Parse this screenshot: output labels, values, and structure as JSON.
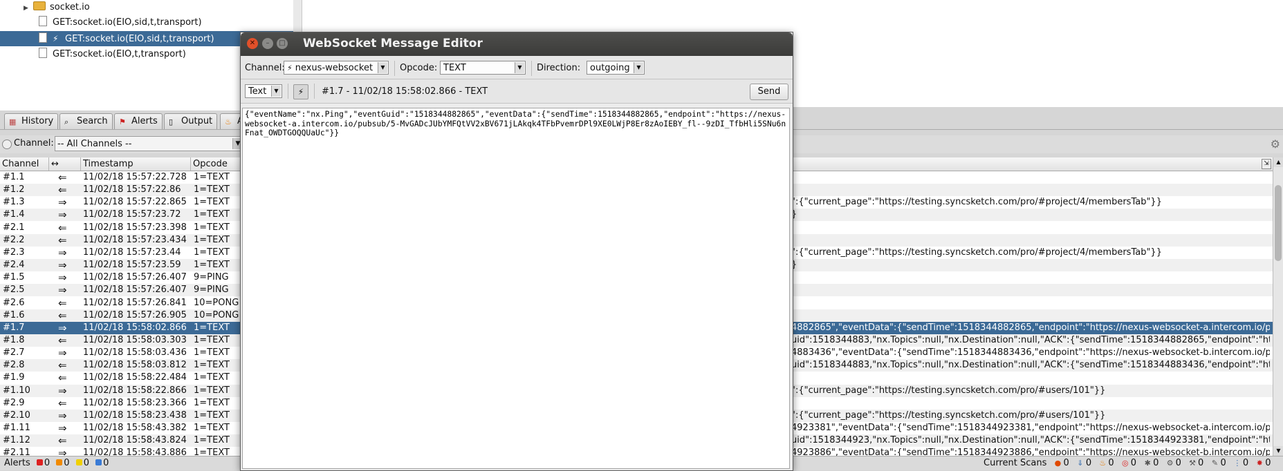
{
  "tree": {
    "folder": "socket.io",
    "items": [
      "GET:socket.io(EIO,sid,t,transport)",
      "GET:socket.io(EIO,sid,t,transport)",
      "GET:socket.io(EIO,t,transport)"
    ]
  },
  "tabs": [
    {
      "label": "History",
      "icon": "calendar-icon"
    },
    {
      "label": "Search",
      "icon": "magnifier-icon"
    },
    {
      "label": "Alerts",
      "icon": "flag-icon"
    },
    {
      "label": "Output",
      "icon": "document-icon"
    },
    {
      "label": "A",
      "icon": "flame-icon"
    }
  ],
  "filter": {
    "label": "Channel:",
    "value": "-- All Channels --"
  },
  "table": {
    "headers": [
      "Channel",
      "↔",
      "Timestamp",
      "Opcode"
    ],
    "rows": [
      {
        "ch": "#1.1",
        "dir": "⇐",
        "ts": "11/02/18 15:57:22.728",
        "op": "1=TEXT",
        "pl": ""
      },
      {
        "ch": "#1.2",
        "dir": "⇐",
        "ts": "11/02/18 15:57:22.86",
        "op": "1=TEXT",
        "pl": ""
      },
      {
        "ch": "#1.3",
        "dir": "⇒",
        "ts": "11/02/18 15:57:22.865",
        "op": "1=TEXT",
        "pl": "\":{\"current_page\":\"https://testing.syncsketch.com/pro/#project/4/membersTab\"}}"
      },
      {
        "ch": "#1.4",
        "dir": "⇒",
        "ts": "11/02/18 15:57:23.72",
        "op": "1=TEXT",
        "pl": "}"
      },
      {
        "ch": "#2.1",
        "dir": "⇐",
        "ts": "11/02/18 15:57:23.398",
        "op": "1=TEXT",
        "pl": ""
      },
      {
        "ch": "#2.2",
        "dir": "⇐",
        "ts": "11/02/18 15:57:23.434",
        "op": "1=TEXT",
        "pl": ""
      },
      {
        "ch": "#2.3",
        "dir": "⇒",
        "ts": "11/02/18 15:57:23.44",
        "op": "1=TEXT",
        "pl": "\":{\"current_page\":\"https://testing.syncsketch.com/pro/#project/4/membersTab\"}}"
      },
      {
        "ch": "#2.4",
        "dir": "⇒",
        "ts": "11/02/18 15:57:23.59",
        "op": "1=TEXT",
        "pl": "}"
      },
      {
        "ch": "#1.5",
        "dir": "⇒",
        "ts": "11/02/18 15:57:26.407",
        "op": "9=PING",
        "pl": ""
      },
      {
        "ch": "#2.5",
        "dir": "⇒",
        "ts": "11/02/18 15:57:26.407",
        "op": "9=PING",
        "pl": ""
      },
      {
        "ch": "#2.6",
        "dir": "⇐",
        "ts": "11/02/18 15:57:26.841",
        "op": "10=PONG",
        "pl": ""
      },
      {
        "ch": "#1.6",
        "dir": "⇐",
        "ts": "11/02/18 15:57:26.905",
        "op": "10=PONG",
        "pl": ""
      },
      {
        "ch": "#1.7",
        "dir": "⇒",
        "ts": "11/02/18 15:58:02.866",
        "op": "1=TEXT",
        "pl": "4882865\",\"eventData\":{\"sendTime\":1518344882865,\"endpoint\":\"https://nexus-websocket-a.intercom.io/pub..."
      },
      {
        "ch": "#1.8",
        "dir": "⇐",
        "ts": "11/02/18 15:58:03.303",
        "op": "1=TEXT",
        "pl": "uid\":1518344883,\"nx.Topics\":null,\"nx.Destination\":null,\"ACK\":{\"sendTime\":1518344882865,\"endpoint\":\"http..."
      },
      {
        "ch": "#2.7",
        "dir": "⇒",
        "ts": "11/02/18 15:58:03.436",
        "op": "1=TEXT",
        "pl": "4883436\",\"eventData\":{\"sendTime\":1518344883436,\"endpoint\":\"https://nexus-websocket-b.intercom.io/pub..."
      },
      {
        "ch": "#2.8",
        "dir": "⇐",
        "ts": "11/02/18 15:58:03.812",
        "op": "1=TEXT",
        "pl": "uid\":1518344883,\"nx.Topics\":null,\"nx.Destination\":null,\"ACK\":{\"sendTime\":1518344883436,\"endpoint\":\"http..."
      },
      {
        "ch": "#1.9",
        "dir": "⇐",
        "ts": "11/02/18 15:58:22.484",
        "op": "1=TEXT",
        "pl": ""
      },
      {
        "ch": "#1.10",
        "dir": "⇒",
        "ts": "11/02/18 15:58:22.866",
        "op": "1=TEXT",
        "pl": "\":{\"current_page\":\"https://testing.syncsketch.com/pro/#users/101\"}}"
      },
      {
        "ch": "#2.9",
        "dir": "⇐",
        "ts": "11/02/18 15:58:23.366",
        "op": "1=TEXT",
        "pl": ""
      },
      {
        "ch": "#2.10",
        "dir": "⇒",
        "ts": "11/02/18 15:58:23.438",
        "op": "1=TEXT",
        "pl": "\":{\"current_page\":\"https://testing.syncsketch.com/pro/#users/101\"}}"
      },
      {
        "ch": "#1.11",
        "dir": "⇒",
        "ts": "11/02/18 15:58:43.382",
        "op": "1=TEXT",
        "pl": "4923381\",\"eventData\":{\"sendTime\":1518344923381,\"endpoint\":\"https://nexus-websocket-a.intercom.io/pub..."
      },
      {
        "ch": "#1.12",
        "dir": "⇐",
        "ts": "11/02/18 15:58:43.824",
        "op": "1=TEXT",
        "pl": "uid\":1518344923,\"nx.Topics\":null,\"nx.Destination\":null,\"ACK\":{\"sendTime\":1518344923381,\"endpoint\":\"http..."
      },
      {
        "ch": "#2.11",
        "dir": "⇒",
        "ts": "11/02/18 15:58:43.886",
        "op": "1=TEXT",
        "pl": "4923886\",\"eventData\":{\"sendTime\":1518344923886,\"endpoint\":\"https://nexus-websocket-b.intercom.io/pub..."
      }
    ]
  },
  "status": {
    "alerts_label": "Alerts",
    "alert_counts": [
      "0",
      "0",
      "0",
      "0"
    ],
    "scans_label": "Current Scans",
    "scan_counts": [
      "0",
      "0",
      "0",
      "0",
      "0",
      "0",
      "0",
      "0",
      "0",
      "0"
    ]
  },
  "dialog": {
    "title": "WebSocket Message Editor",
    "channel_label": "Channel:",
    "channel_value": "nexus-websocket",
    "opcode_label": "Opcode:",
    "opcode_value": "TEXT",
    "direction_label": "Direction:",
    "direction_value": "outgoing",
    "format_value": "Text",
    "message_info": "#1.7 - 11/02/18 15:58:02.866 - TEXT",
    "send_label": "Send",
    "message": "{\"eventName\":\"nx.Ping\",\"eventGuid\":\"1518344882865\",\"eventData\":{\"sendTime\":1518344882865,\"endpoint\":\"https://nexus-websocket-a.intercom.io/pubsub/5-MvGADcJUbYMFQtVV2xBV671jLAkqk4TFbPvemrDPl9XE0LWjP8Er8zAoIEBY_fl--9zDI_TfbHli5SNu6nFnat_OWDTGOQQUaUc\"}}"
  },
  "colors": {
    "selection": "#3c6a96",
    "titlebar": "#3b3b39",
    "close": "#e0502a"
  }
}
